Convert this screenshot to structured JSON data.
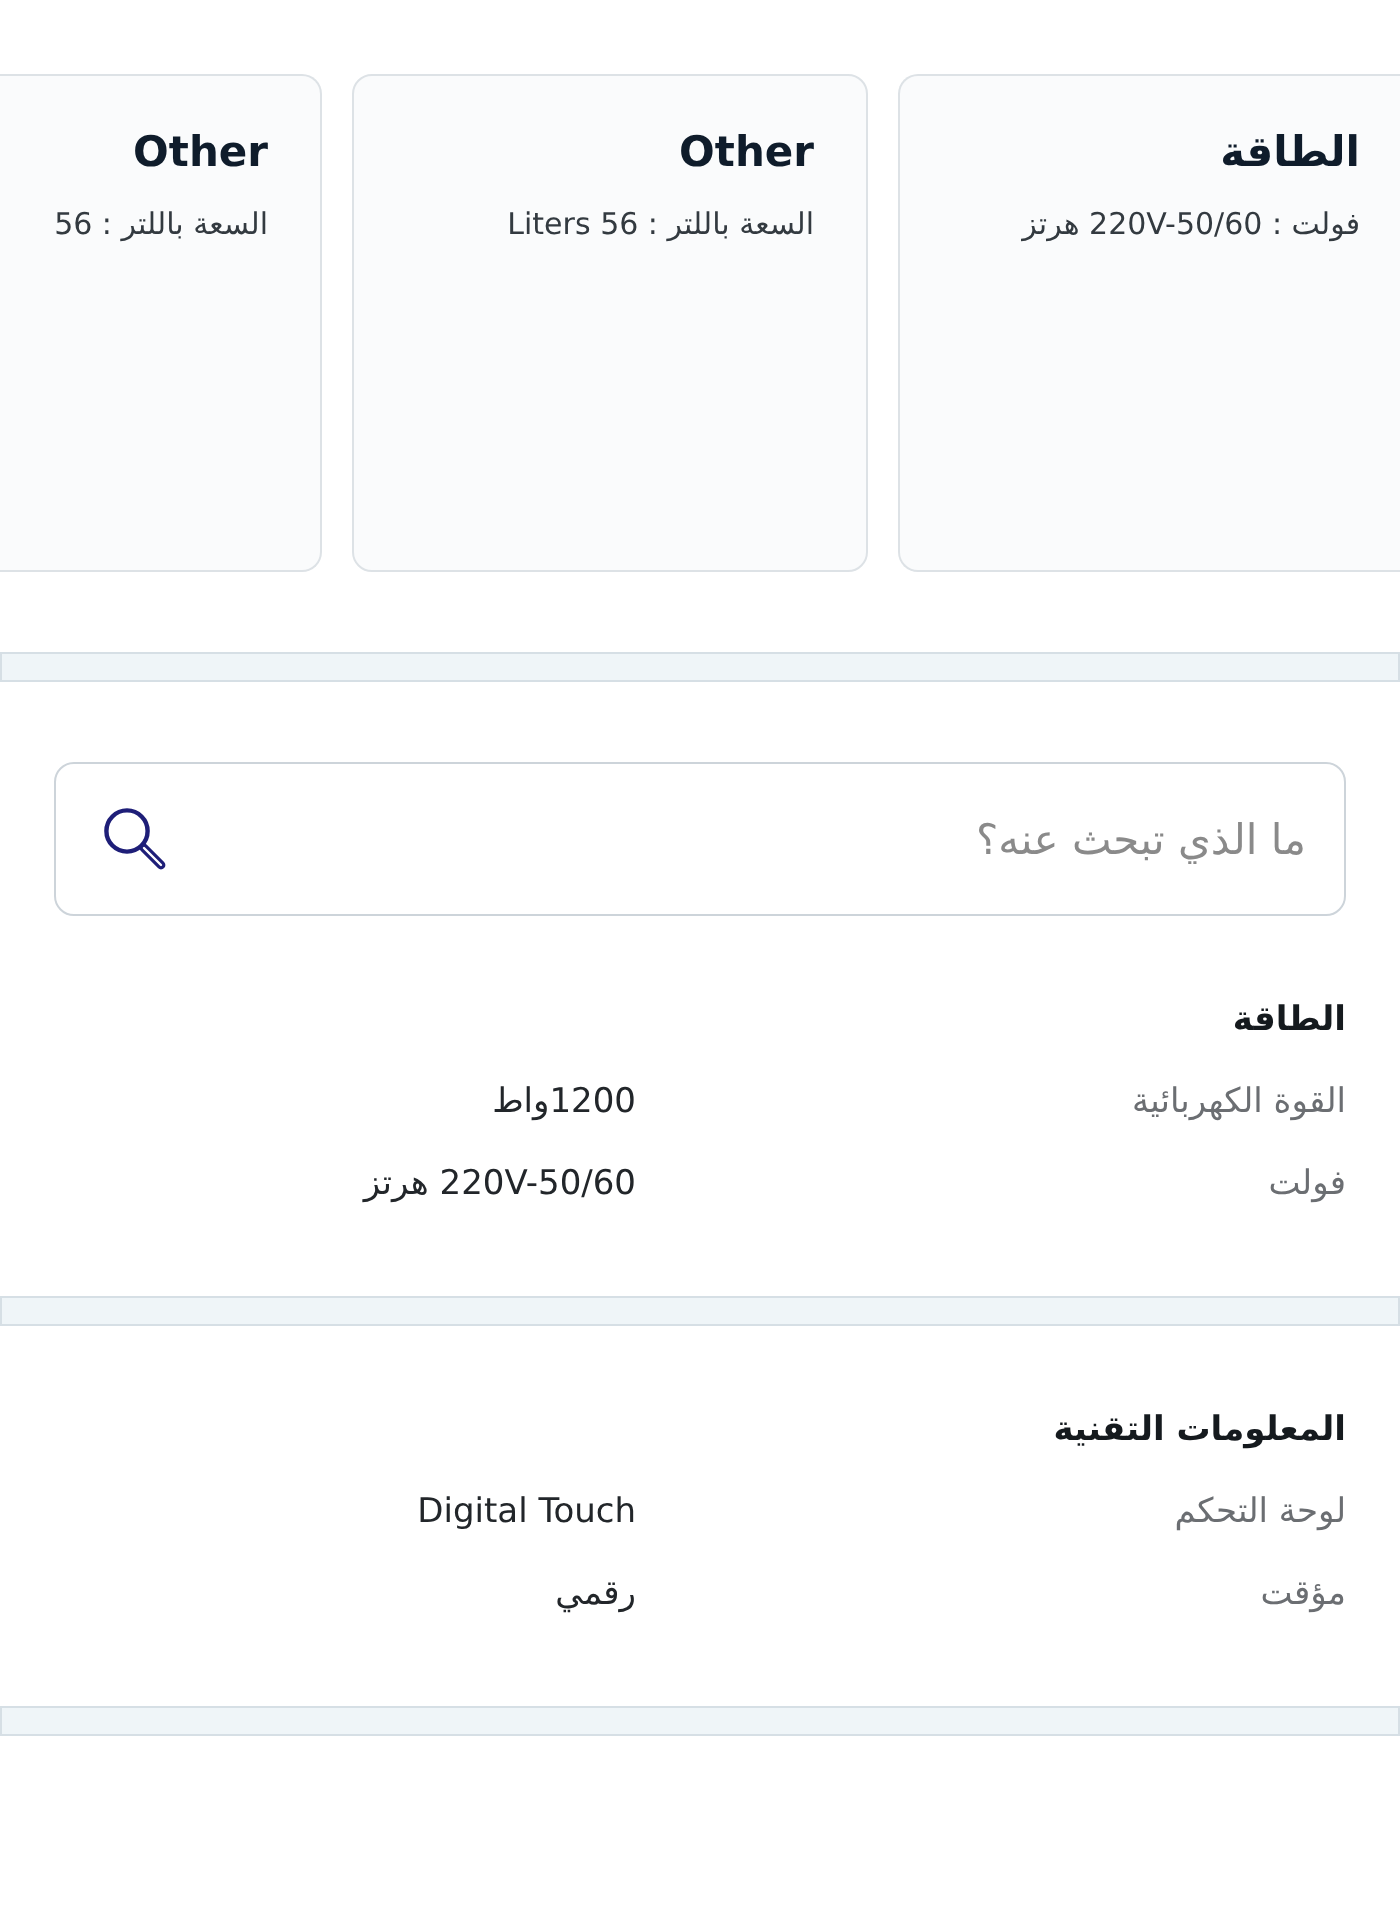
{
  "cards": [
    {
      "title": "الطاقة",
      "detail": "فولت : 220V-50/60 هرتز"
    },
    {
      "title": "Other",
      "detail": "السعة باللتر : 56 Liters"
    },
    {
      "title": "Other",
      "detail": "السعة باللتر : 56"
    }
  ],
  "search": {
    "placeholder": "ما الذي تبحث عنه؟"
  },
  "sections": [
    {
      "heading": "الطاقة",
      "rows": [
        {
          "label": "القوة الكهربائية",
          "value": "1200واط"
        },
        {
          "label": "فولت",
          "value": "220V-50/60 هرتز"
        }
      ]
    },
    {
      "heading": "المعلومات التقنية",
      "rows": [
        {
          "label": "لوحة التحكم",
          "value": "Digital Touch"
        },
        {
          "label": "مؤقت",
          "value": "رقمي"
        }
      ]
    }
  ]
}
